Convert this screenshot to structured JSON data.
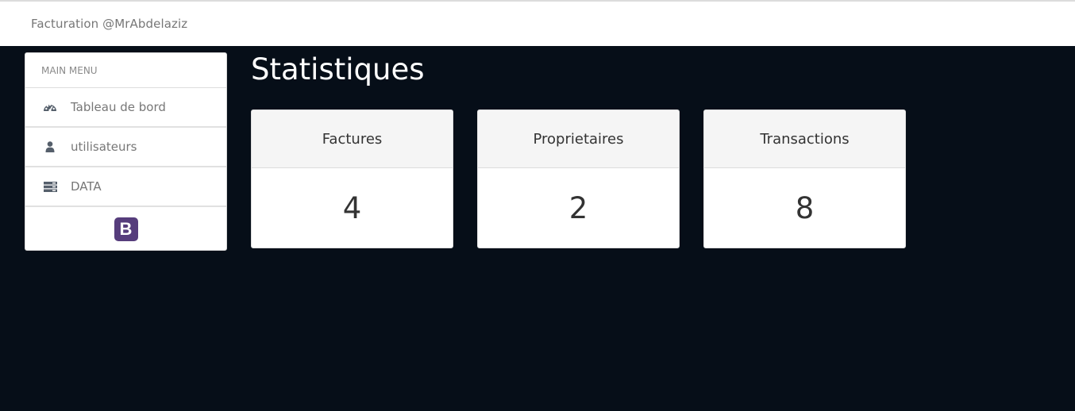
{
  "navbar": {
    "brand": "Facturation @MrAbdelaziz"
  },
  "sidebar": {
    "header": "MAIN MENU",
    "items": [
      {
        "label": "Tableau de bord",
        "icon": "dashboard-icon"
      },
      {
        "label": "utilisateurs",
        "icon": "user-icon"
      },
      {
        "label": "DATA",
        "icon": "server-icon"
      }
    ],
    "footer_logo": "B"
  },
  "main": {
    "title": "Statistiques",
    "cards": [
      {
        "title": "Factures",
        "value": "4"
      },
      {
        "title": "Proprietaires",
        "value": "2"
      },
      {
        "title": "Transactions",
        "value": "8"
      }
    ]
  },
  "colors": {
    "page_background": "#060e18",
    "bootstrap_purple": "#563d7c",
    "card_header_bg": "#f5f5f5",
    "icon_color": "#555f6b"
  }
}
